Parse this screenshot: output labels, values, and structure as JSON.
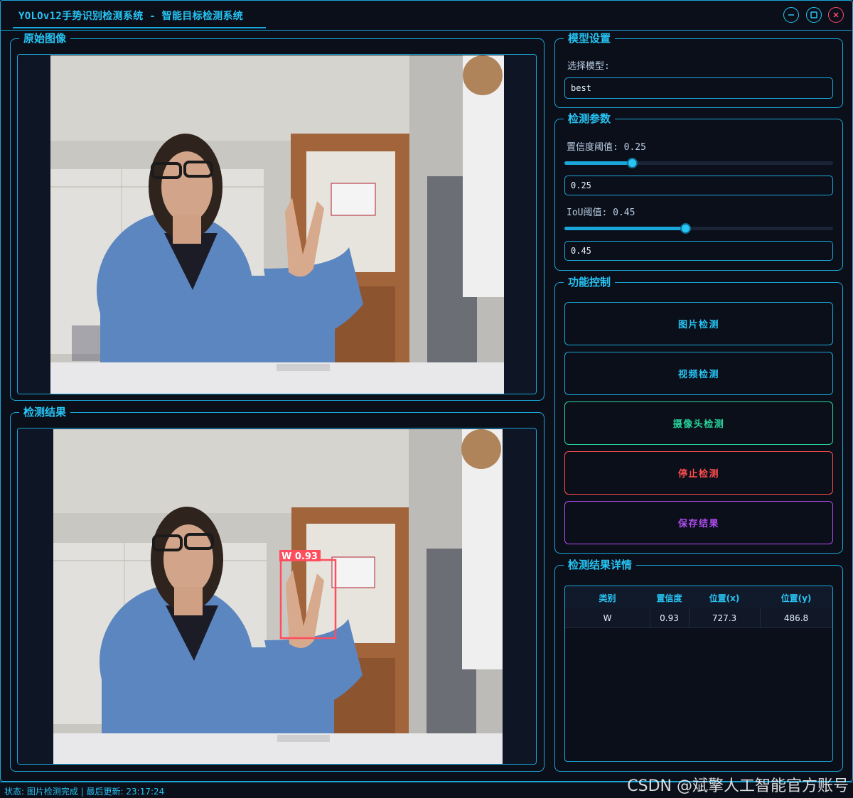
{
  "window": {
    "title": "YOLOv12手势识别检测系统 - 智能目标检测系统",
    "minimize_icon": "minimize-icon",
    "maximize_icon": "maximize-icon",
    "close_icon": "close-icon"
  },
  "original_panel": {
    "title": "原始图像"
  },
  "result_panel": {
    "title": "检测结果",
    "detection_label": "W 0.93"
  },
  "model_settings": {
    "title": "模型设置",
    "select_label": "选择模型:",
    "model_value": "best"
  },
  "detection_params": {
    "title": "检测参数",
    "confidence_label": "置信度阈值: 0.25",
    "confidence_value": "0.25",
    "confidence_level": 0.25,
    "iou_label": "IoU阈值: 0.45",
    "iou_value": "0.45",
    "iou_level": 0.45
  },
  "controls": {
    "title": "功能控制",
    "image_detect": "图片检测",
    "video_detect": "视频检测",
    "camera_detect": "摄像头检测",
    "stop_detect": "停止检测",
    "save_result": "保存结果"
  },
  "results_detail": {
    "title": "检测结果详情",
    "columns": [
      "类别",
      "置信度",
      "位置(x)",
      "位置(y)"
    ],
    "rows": [
      [
        "W",
        "0.93",
        "727.3",
        "486.8"
      ]
    ]
  },
  "status": {
    "text": "状态: 图片检测完成 | 最后更新: 23:17:24"
  },
  "watermark": "CSDN @斌擎人工智能官方账号",
  "colors": {
    "accent": "#27c5f5",
    "border": "#1aa6d8",
    "background": "#0b0f1a",
    "camera_button": "#28d39a",
    "stop_button": "#ff4d4d",
    "save_button": "#b04df0",
    "bbox": "#ff4d5e"
  }
}
